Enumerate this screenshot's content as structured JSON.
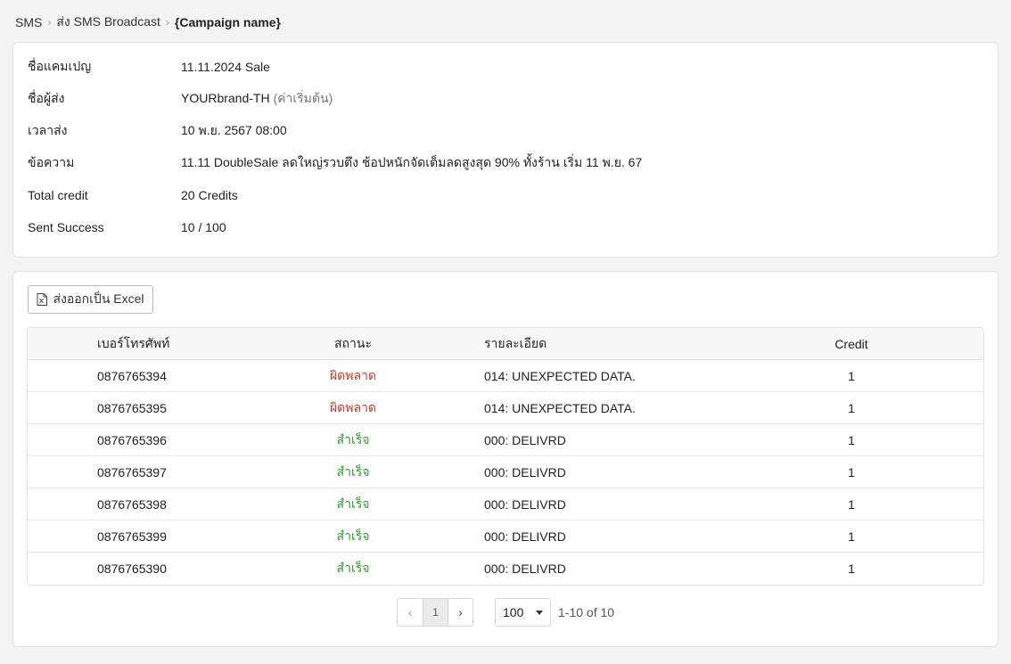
{
  "breadcrumb": {
    "items": [
      "SMS",
      "ส่ง SMS Broadcast"
    ],
    "current": "{Campaign name}"
  },
  "info": [
    {
      "label": "ชื่อแคมเปญ",
      "value": "11.11.2024 Sale",
      "extra": ""
    },
    {
      "label": "ชื่อผู้ส่ง",
      "value": "YOURbrand-TH",
      "extra": "(ค่าเริ่มต้น)"
    },
    {
      "label": "เวลาส่ง",
      "value": "10 พ.ย. 2567 08:00",
      "extra": ""
    },
    {
      "label": "ข้อความ",
      "value": "11.11 DoubleSale ลดใหญ่รวบตึง ช้อปหนักจัดเต็มลดสูงสุด 90% ทั้งร้าน เริ่ม 11 พ.ย. 67",
      "extra": ""
    },
    {
      "label": "Total credit",
      "value": "20 Credits",
      "extra": ""
    },
    {
      "label": "Sent Success",
      "value": "10 / 100",
      "extra": ""
    }
  ],
  "export_button": {
    "label": "ส่งออกเป็น Excel",
    "icon": "excel-file-icon"
  },
  "table": {
    "headers": {
      "phone": "เบอร์โทรศัพท์",
      "status": "สถานะ",
      "detail": "รายละเอียด",
      "credit": "Credit"
    },
    "rows": [
      {
        "phone": "0876765394",
        "status": "ผิดพลาด",
        "status_type": "fail",
        "detail": "014: UNEXPECTED DATA.",
        "credit": "1"
      },
      {
        "phone": "0876765395",
        "status": "ผิดพลาด",
        "status_type": "fail",
        "detail": "014: UNEXPECTED DATA.",
        "credit": "1"
      },
      {
        "phone": "0876765396",
        "status": "สำเร็จ",
        "status_type": "ok",
        "detail": "000: DELIVRD",
        "credit": "1"
      },
      {
        "phone": "0876765397",
        "status": "สำเร็จ",
        "status_type": "ok",
        "detail": "000: DELIVRD",
        "credit": "1"
      },
      {
        "phone": "0876765398",
        "status": "สำเร็จ",
        "status_type": "ok",
        "detail": "000: DELIVRD",
        "credit": "1"
      },
      {
        "phone": "0876765399",
        "status": "สำเร็จ",
        "status_type": "ok",
        "detail": "000: DELIVRD",
        "credit": "1"
      },
      {
        "phone": "0876765390",
        "status": "สำเร็จ",
        "status_type": "ok",
        "detail": "000: DELIVRD",
        "credit": "1"
      }
    ]
  },
  "pagination": {
    "current_page": "1",
    "page_size": "100",
    "range": "1-10 of 10"
  },
  "colors": {
    "fail": "#c0392b",
    "ok": "#2e9a2e"
  }
}
